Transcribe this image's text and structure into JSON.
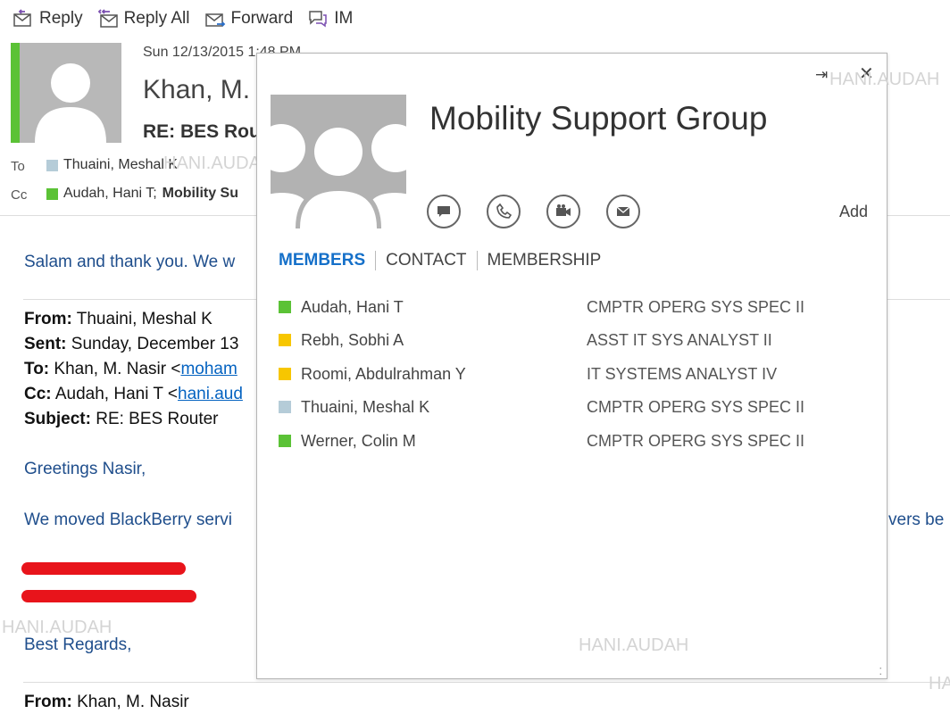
{
  "toolbar": {
    "reply": "Reply",
    "reply_all": "Reply All",
    "forward": "Forward",
    "im": "IM"
  },
  "message": {
    "date": "Sun 12/13/2015 1:48 PM",
    "sender": "Khan, M.",
    "subject": "RE: BES Rou",
    "to_label": "To",
    "to_name": "Thuaini, Meshal K",
    "cc_label": "Cc",
    "cc_name": "Audah, Hani T;",
    "cc_group": "Mobility Su"
  },
  "body": {
    "salam": "Salam and thank you.  We w",
    "from_label": "From:",
    "from_value": " Thuaini, Meshal K",
    "sent_label": "Sent:",
    "sent_value": " Sunday, December 13",
    "to_label": "To:",
    "to_value": " Khan, M. Nasir <",
    "to_link": "moham",
    "cc_label": "Cc:",
    "cc_value": " Audah, Hani T <",
    "cc_link": "hani.aud",
    "subject_label": "Subject:",
    "subject_value": " RE: BES Router",
    "greeting": "Greetings Nasir,",
    "moved": "We moved BlackBerry servi",
    "moved_tail": "vers be",
    "regards": "Best Regards,",
    "from2_label": "From:",
    "from2_value": " Khan, M. Nasir"
  },
  "watermarks": {
    "w1": "HANI.AUDAH",
    "w2": "HANI.AUDAH",
    "w3": "HANI.AUDAH",
    "w4": "HANI.AUDAH",
    "w5": "HA"
  },
  "card": {
    "title": "Mobility Support Group",
    "pin": "⇥",
    "close": "✕",
    "add": "Add",
    "tabs": [
      "MEMBERS",
      "CONTACT",
      "MEMBERSHIP"
    ],
    "members": [
      {
        "name": "Audah, Hani T",
        "title": "CMPTR OPERG SYS SPEC II",
        "status": "available"
      },
      {
        "name": "Rebh, Sobhi A",
        "title": "ASST IT SYS ANALYST II",
        "status": "away"
      },
      {
        "name": "Roomi, Abdulrahman Y",
        "title": "IT SYSTEMS ANALYST IV",
        "status": "away"
      },
      {
        "name": "Thuaini, Meshal K",
        "title": "CMPTR OPERG SYS SPEC II",
        "status": "offline"
      },
      {
        "name": "Werner, Colin M",
        "title": "CMPTR OPERG SYS SPEC II",
        "status": "available"
      }
    ],
    "grip": "⁚"
  },
  "colors": {
    "available": "#5bc236",
    "away": "#f7c600",
    "offline": "#b5ccd8",
    "active_tab": "#1570c9",
    "body_blue": "#1f4e8c",
    "redaction": "#e8141b"
  },
  "icons": {
    "reply": "reply-icon",
    "reply_all": "reply-all-icon",
    "forward": "forward-icon",
    "im": "im-icon",
    "chat": "chat-icon",
    "phone": "phone-icon",
    "video": "video-icon",
    "email": "email-icon"
  }
}
